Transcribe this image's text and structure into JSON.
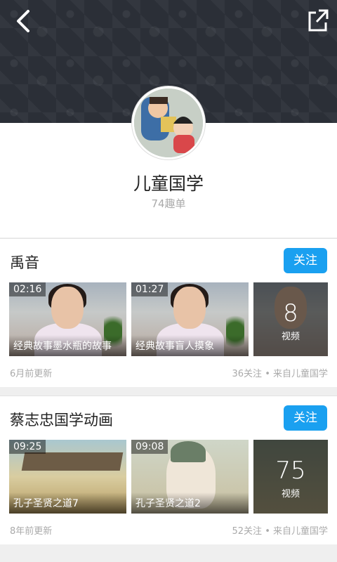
{
  "header": {
    "back_icon": "back-arrow-icon",
    "share_icon": "external-link-icon"
  },
  "profile": {
    "name": "儿童国学",
    "subscription_count": "74趣单"
  },
  "cards": [
    {
      "title": "禹音",
      "follow_label": "关注",
      "thumbs": [
        {
          "duration": "02:16",
          "caption": "经典故事墨水瓶的故事"
        },
        {
          "duration": "01:27",
          "caption": "经典故事盲人摸象"
        }
      ],
      "more": {
        "count": "8",
        "label": "视频"
      },
      "updated": "6月前更新",
      "meta": "36关注 • 来自儿童国学"
    },
    {
      "title": "蔡志忠国学动画",
      "follow_label": "关注",
      "thumbs": [
        {
          "duration": "09:25",
          "caption": "孔子圣贤之道7"
        },
        {
          "duration": "09:08",
          "caption": "孔子圣贤之道2"
        }
      ],
      "more": {
        "count": "75",
        "label": "视频"
      },
      "updated": "8年前更新",
      "meta": "52关注 • 来自儿童国学"
    }
  ],
  "colors": {
    "header_bg": "#2b2f37",
    "follow_button": "#1aa0f0",
    "page_bg": "#efefef"
  }
}
